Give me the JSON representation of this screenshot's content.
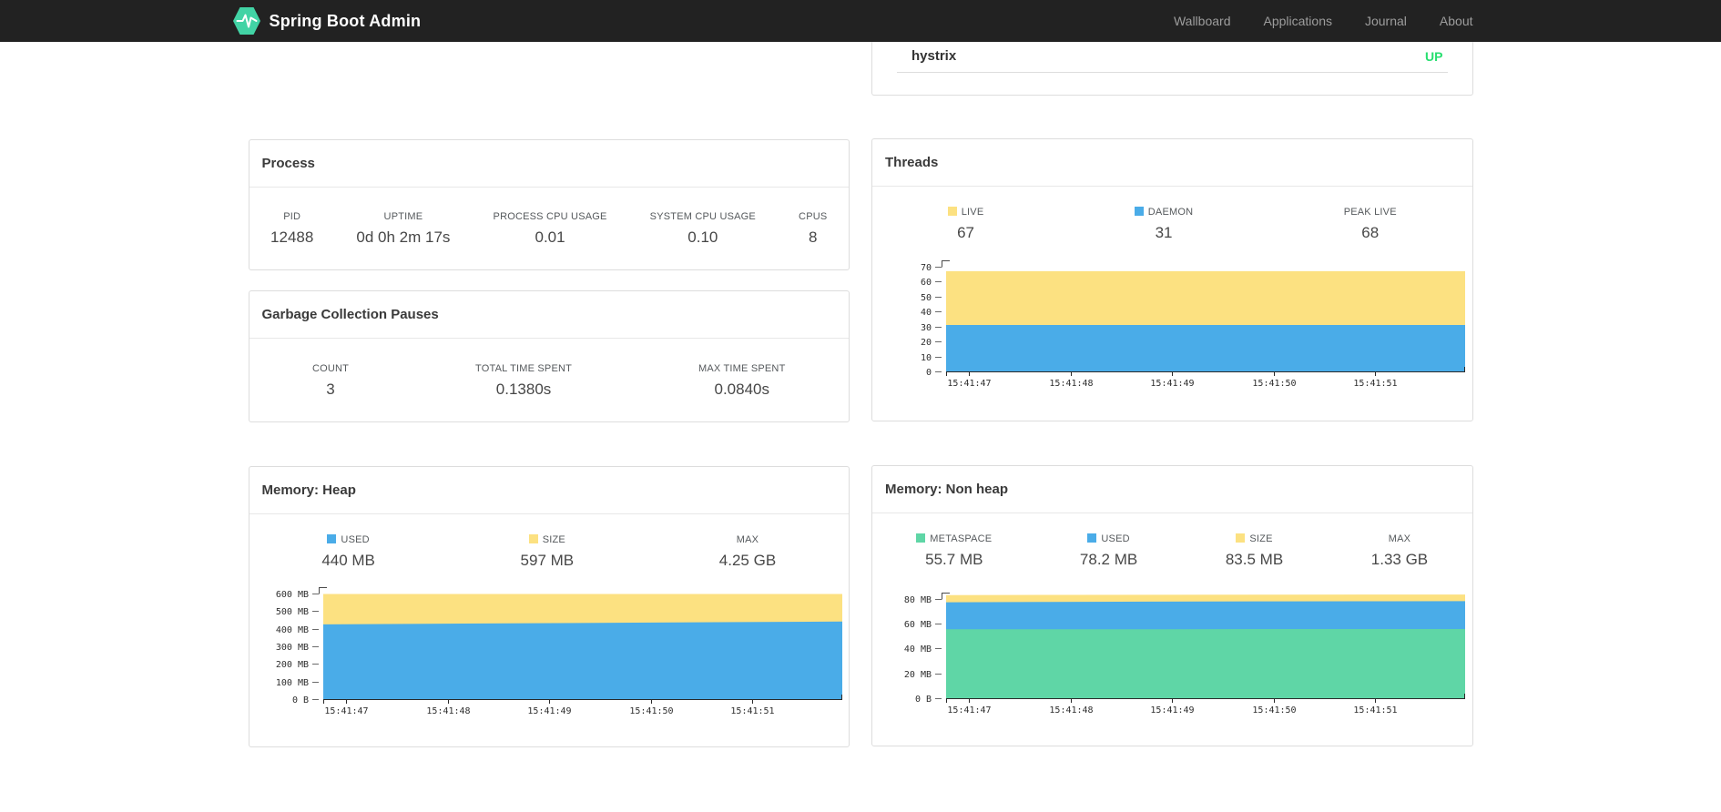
{
  "navbar": {
    "brand": "Spring Boot Admin",
    "brand_color": "#42D3A5",
    "items": [
      {
        "label": "Wallboard"
      },
      {
        "label": "Applications"
      },
      {
        "label": "Journal"
      },
      {
        "label": "About"
      }
    ]
  },
  "service": {
    "name": "hystrix",
    "status": "UP",
    "status_color": "#28DF70"
  },
  "process": {
    "title": "Process",
    "stats": [
      {
        "label": "PID",
        "value": "12488"
      },
      {
        "label": "UPTIME",
        "value": "0d 0h 2m 17s"
      },
      {
        "label": "PROCESS CPU USAGE",
        "value": "0.01"
      },
      {
        "label": "SYSTEM CPU USAGE",
        "value": "0.10"
      },
      {
        "label": "CPUS",
        "value": "8"
      }
    ]
  },
  "gc": {
    "title": "Garbage Collection Pauses",
    "stats": [
      {
        "label": "COUNT",
        "value": "3"
      },
      {
        "label": "TOTAL TIME SPENT",
        "value": "0.1380s"
      },
      {
        "label": "MAX TIME SPENT",
        "value": "0.0840s"
      }
    ]
  },
  "threads": {
    "title": "Threads",
    "stats": [
      {
        "label": "LIVE",
        "value": "67",
        "color": "#FCE181"
      },
      {
        "label": "DAEMON",
        "value": "31",
        "color": "#4AACE8"
      },
      {
        "label": "PEAK LIVE",
        "value": "68"
      }
    ]
  },
  "heap": {
    "title": "Memory: Heap",
    "stats": [
      {
        "label": "USED",
        "value": "440 MB",
        "color": "#4AACE8"
      },
      {
        "label": "SIZE",
        "value": "597 MB",
        "color": "#FCE181"
      },
      {
        "label": "MAX",
        "value": "4.25 GB"
      }
    ]
  },
  "nonheap": {
    "title": "Memory: Non heap",
    "stats": [
      {
        "label": "METASPACE",
        "value": "55.7 MB",
        "color": "#5FD6A6"
      },
      {
        "label": "USED",
        "value": "78.2 MB",
        "color": "#4AACE8"
      },
      {
        "label": "SIZE",
        "value": "83.5 MB",
        "color": "#FCE181"
      },
      {
        "label": "MAX",
        "value": "1.33 GB"
      }
    ]
  },
  "chart_data": [
    {
      "id": "threads-chart",
      "type": "area",
      "title": "Threads",
      "x_ticks": [
        "15:41:47",
        "15:41:48",
        "15:41:49",
        "15:41:50",
        "15:41:51"
      ],
      "y_ticks": [
        {
          "value": 0,
          "label": "0"
        },
        {
          "value": 10,
          "label": "10"
        },
        {
          "value": 20,
          "label": "20"
        },
        {
          "value": 30,
          "label": "30"
        },
        {
          "value": 40,
          "label": "40"
        },
        {
          "value": 50,
          "label": "50"
        },
        {
          "value": 60,
          "label": "60"
        },
        {
          "value": 70,
          "label": "70"
        }
      ],
      "ymax": 73,
      "series": [
        {
          "name": "LIVE",
          "color": "#FCE181",
          "values": [
            67,
            67,
            67,
            67,
            67,
            67
          ]
        },
        {
          "name": "DAEMON",
          "color": "#4AACE8",
          "values": [
            31,
            31,
            31,
            31,
            31,
            31
          ]
        }
      ]
    },
    {
      "id": "heap-chart",
      "type": "area",
      "title": "Memory: Heap",
      "x_ticks": [
        "15:41:47",
        "15:41:48",
        "15:41:49",
        "15:41:50",
        "15:41:51"
      ],
      "y_ticks": [
        {
          "value": 0,
          "label": "0 B"
        },
        {
          "value": 100,
          "label": "100 MB"
        },
        {
          "value": 200,
          "label": "200 MB"
        },
        {
          "value": 300,
          "label": "300 MB"
        },
        {
          "value": 400,
          "label": "400 MB"
        },
        {
          "value": 500,
          "label": "500 MB"
        },
        {
          "value": 600,
          "label": "600 MB"
        }
      ],
      "ymax": 620,
      "series": [
        {
          "name": "USED",
          "color": "#4AACE8",
          "values": [
            424,
            428,
            431,
            434,
            437,
            440
          ]
        },
        {
          "name": "SIZE",
          "color": "#FCE181",
          "values": [
            597,
            597,
            597,
            597,
            597,
            597
          ]
        }
      ]
    },
    {
      "id": "nonheap-chart",
      "type": "area",
      "title": "Memory: Non heap",
      "x_ticks": [
        "15:41:47",
        "15:41:48",
        "15:41:49",
        "15:41:50",
        "15:41:51"
      ],
      "y_ticks": [
        {
          "value": 0,
          "label": "0 B"
        },
        {
          "value": 20,
          "label": "20 MB"
        },
        {
          "value": 40,
          "label": "40 MB"
        },
        {
          "value": 60,
          "label": "60 MB"
        },
        {
          "value": 80,
          "label": "80 MB"
        }
      ],
      "ymax": 88,
      "series": [
        {
          "name": "METASPACE",
          "color": "#5FD6A6",
          "values": [
            55.5,
            55.6,
            55.6,
            55.7,
            55.7,
            55.7
          ]
        },
        {
          "name": "USED",
          "color": "#4AACE8",
          "values": [
            77.3,
            77.6,
            77.8,
            78.0,
            78.1,
            78.2
          ]
        },
        {
          "name": "SIZE",
          "color": "#FCE181",
          "values": [
            83.0,
            83.2,
            83.3,
            83.4,
            83.5,
            83.5
          ]
        }
      ]
    }
  ]
}
